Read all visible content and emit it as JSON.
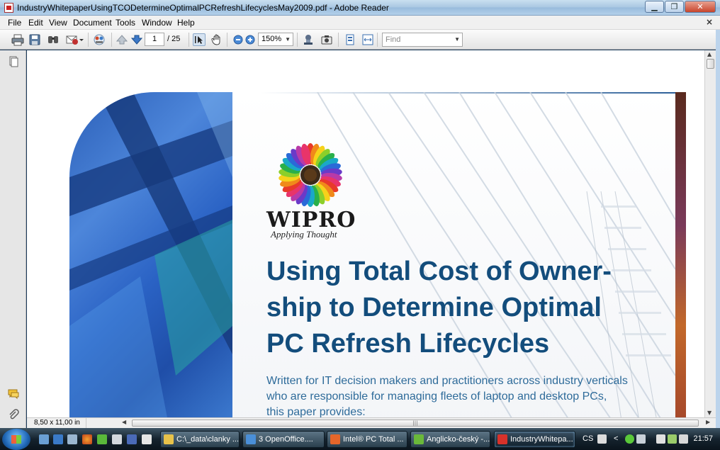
{
  "window": {
    "title": "IndustryWhitepaperUsingTCODetermineOptimalPCRefreshLifecyclesMay2009.pdf - Adobe Reader",
    "minimize": "▁",
    "maximize": "❐",
    "close": "✕"
  },
  "menu": {
    "items": [
      "File",
      "Edit",
      "View",
      "Document",
      "Tools",
      "Window",
      "Help"
    ],
    "doc_close": "×"
  },
  "toolbar": {
    "current_page": "1",
    "page_total": "/ 25",
    "zoom": "150%",
    "find_placeholder": "Find",
    "icons": [
      "print-icon",
      "save-icon",
      "search-icon",
      "email-icon",
      "collaborate-icon",
      "prev-page-icon",
      "next-page-icon",
      "select-tool-icon",
      "hand-tool-icon",
      "zoom-out-icon",
      "zoom-in-icon",
      "stamp-icon",
      "snapshot-icon",
      "fit-page-icon",
      "fit-width-icon"
    ]
  },
  "status": {
    "page_size": "8,50 x 11,00 in"
  },
  "document": {
    "logo_word": "WIPRO",
    "logo_tagline": "Applying Thought",
    "heading_lines": [
      "Using Total Cost of Owner-",
      "ship to Determine Optimal",
      "PC Refresh Lifecycles"
    ],
    "intro_lines": [
      "Written for IT decision makers and practitioners across industry verticals",
      "who are responsible for managing fleets of laptop and desktop PCs,",
      "this paper provides:"
    ]
  },
  "taskbar": {
    "tasks": [
      {
        "label": "C:\\_data\\clanky ...",
        "icon_color": "#e8c24a"
      },
      {
        "label": "3 OpenOffice....",
        "icon_color": "#4a8fd8"
      },
      {
        "label": "Intel® PC Total ...",
        "icon_color": "#e5662a"
      },
      {
        "label": "Anglicko-český -...",
        "icon_color": "#6ab83a"
      },
      {
        "label": "IndustryWhitepa...",
        "icon_color": "#d8322a"
      }
    ],
    "language": "CS",
    "tray_arrow": "<",
    "clock": "21:57"
  },
  "colors": {
    "heading": "#134d7c",
    "intro": "#2e6b9a",
    "taskbar": "#15232e"
  }
}
